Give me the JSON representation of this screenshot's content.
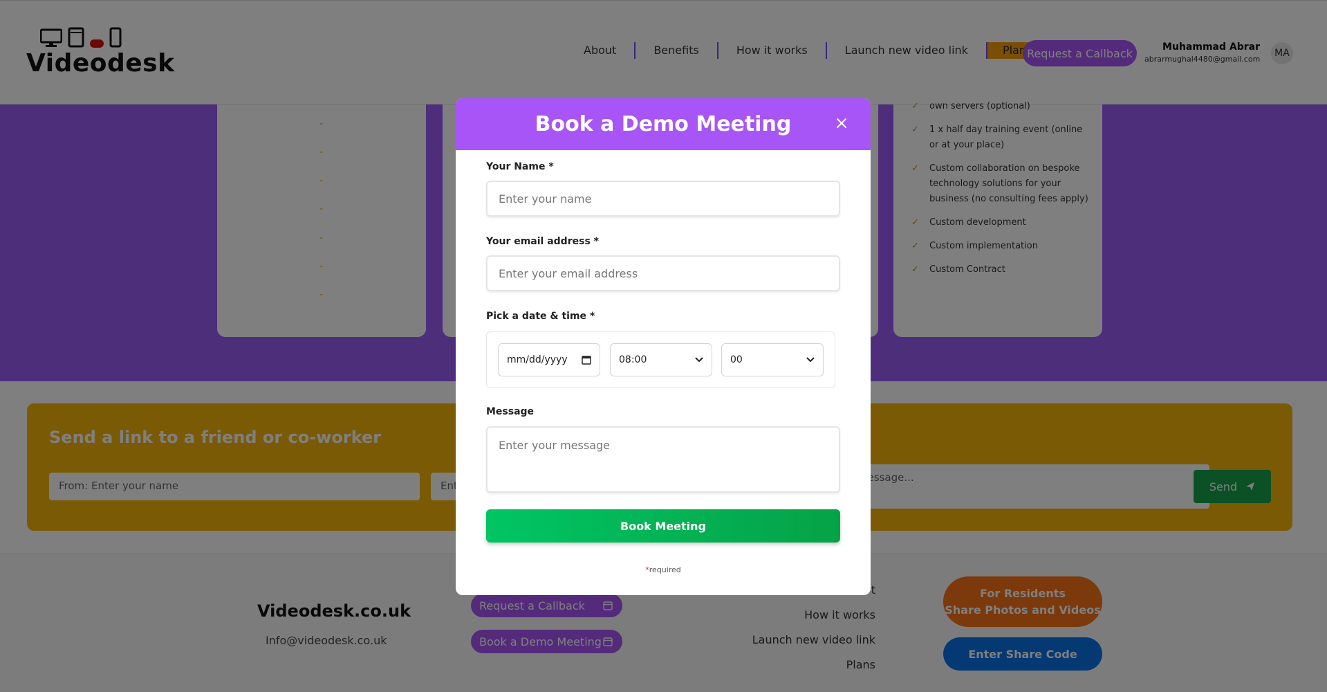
{
  "header": {
    "logo_text": "Videodesk",
    "nav": [
      "About",
      "Benefits",
      "How it works",
      "Launch new video link"
    ],
    "plans_label": "Plans",
    "callback_label": "Request a Callback",
    "user_name": "Muhammad Abrar",
    "user_email": "abrarmughal4480@gmail.com",
    "avatar_initials": "MA"
  },
  "plans": {
    "dash": "-",
    "features": [
      "own servers (optional)",
      "1 x half day training event (online or at your place)",
      "Custom collaboration on bespoke technology solutions for your business (no consulting fees apply)",
      "Custom development",
      "Custom implementation",
      "Custom Contract"
    ]
  },
  "share": {
    "title": "Send a link to a friend or co-worker",
    "from_placeholder": "From: Enter your name",
    "to_placeholder": "Ent",
    "message_placeholder": "r message...",
    "send_label": "Send"
  },
  "footer": {
    "site": "Videodesk.co.uk",
    "email": "Info@videodesk.co.uk",
    "callback_label": "Request a Callback",
    "demo_label": "Book a Demo Meeting",
    "links": [
      "t",
      "How it works",
      "Launch new video link",
      "Plans"
    ],
    "residents_line1": "For Residents",
    "residents_line2": "Share Photos and Videos",
    "share_code_label": "Enter Share Code"
  },
  "modal": {
    "title": "Book a Demo Meeting",
    "name_label": "Your Name *",
    "name_placeholder": "Enter your name",
    "email_label": "Your email address *",
    "email_placeholder": "Enter your email address",
    "date_label": "Pick a date & time *",
    "date_placeholder": "mm/dd/yyyy",
    "hour_value": "08:00",
    "minute_value": "00",
    "message_label": "Message",
    "message_placeholder": "Enter your message",
    "book_button": "Book Meeting",
    "required_star": "*",
    "required_text": "required"
  },
  "colors": {
    "brand_purple": "#a855f7",
    "accent_orange": "#f59e0b",
    "success_green": "#16a34a"
  }
}
